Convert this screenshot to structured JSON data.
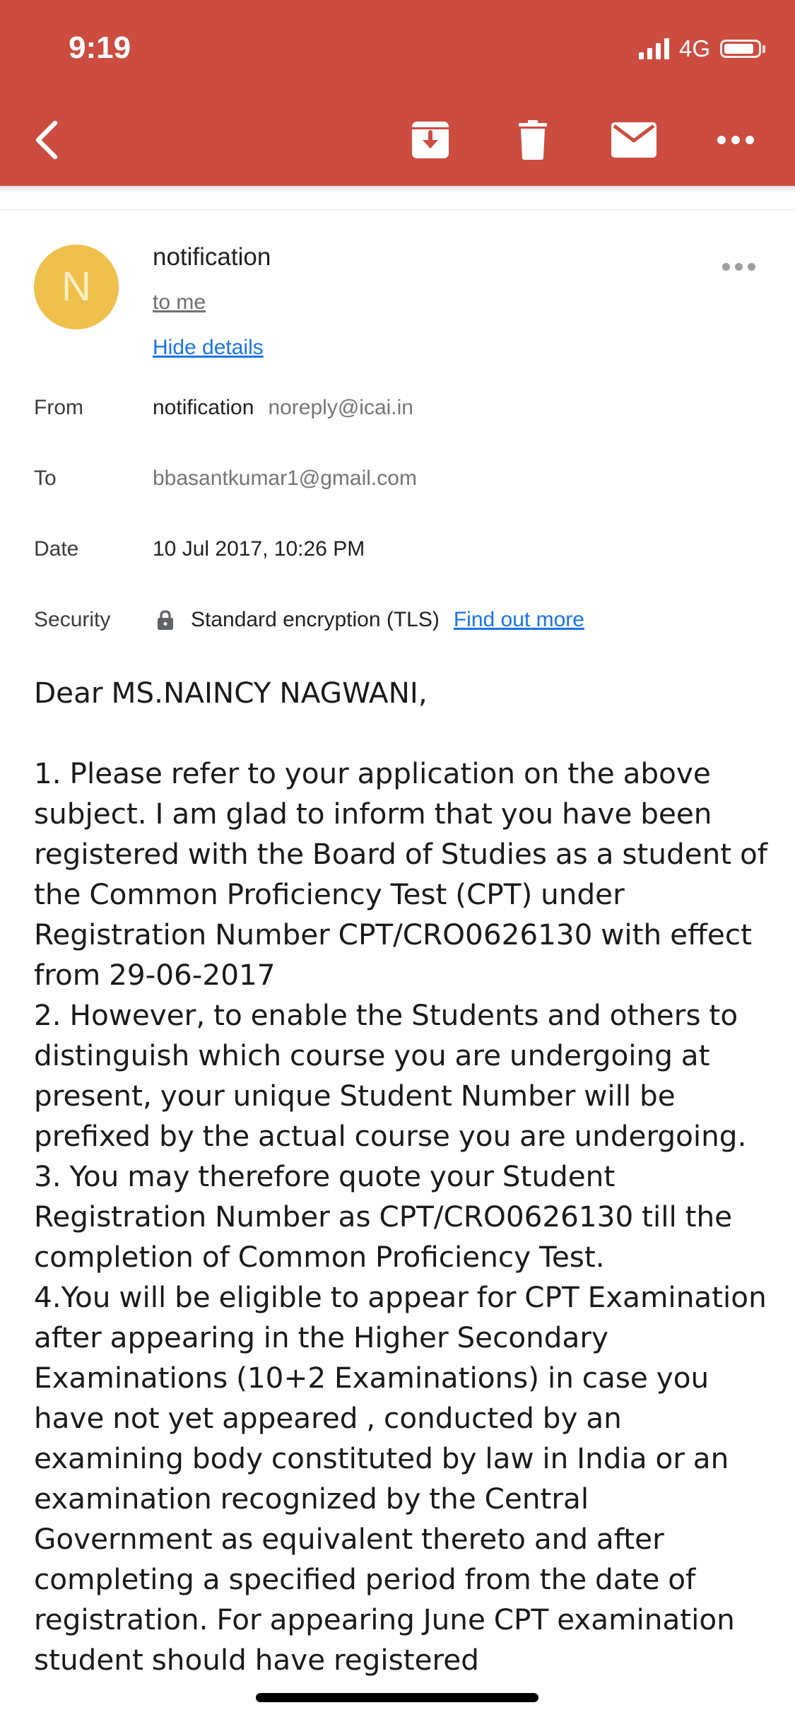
{
  "status_bar": {
    "time": "9:19",
    "network": "4G",
    "battery_level": 0.9
  },
  "toolbar": {
    "back_icon": "back-arrow-icon",
    "archive_icon": "archive-icon",
    "delete_icon": "trash-icon",
    "mark_unread_icon": "mail-icon",
    "more_icon": "more-horizontal-icon",
    "accent_color": "#cc4c40"
  },
  "sender": {
    "avatar_letter": "N",
    "avatar_color": "#efc04b",
    "name": "notification",
    "to_me": "to me",
    "hide_details": "Hide details"
  },
  "details": {
    "from": {
      "label": "From",
      "name": "notification",
      "email": "noreply@icai.in"
    },
    "to": {
      "label": "To",
      "value": "bbasantkumar1@gmail.com"
    },
    "date": {
      "label": "Date",
      "value": "10 Jul 2017, 10:26 PM"
    },
    "security": {
      "label": "Security",
      "value": "Standard encryption (TLS)",
      "link": "Find out more"
    }
  },
  "body": {
    "greeting": "Dear MS.NAINCY NAGWANI,",
    "text": "1. Please refer to your application on the above subject. I am glad to inform that you have been registered with the Board of Studies as a student of the Common Proficiency Test (CPT) under Registration Number CPT/CRO0626130 with effect from 29-06-2017\n2. However, to enable the Students and others to distinguish which course you are undergoing at present, your unique Student Number will be prefixed by the actual course you are undergoing.\n3. You may therefore quote your Student Registration Number as CPT/CRO0626130 till the completion of Common Proficiency Test.\n4.You will be eligible to appear for CPT Examination after appearing in the Higher Secondary Examinations (10+2 Examinations) in case you have not yet appeared , conducted by an examining body constituted by law in India or an examination recognized by the Central Government as equivalent thereto and after completing a specified period from the date of registration. For appearing June CPT examination student should have registered"
  }
}
